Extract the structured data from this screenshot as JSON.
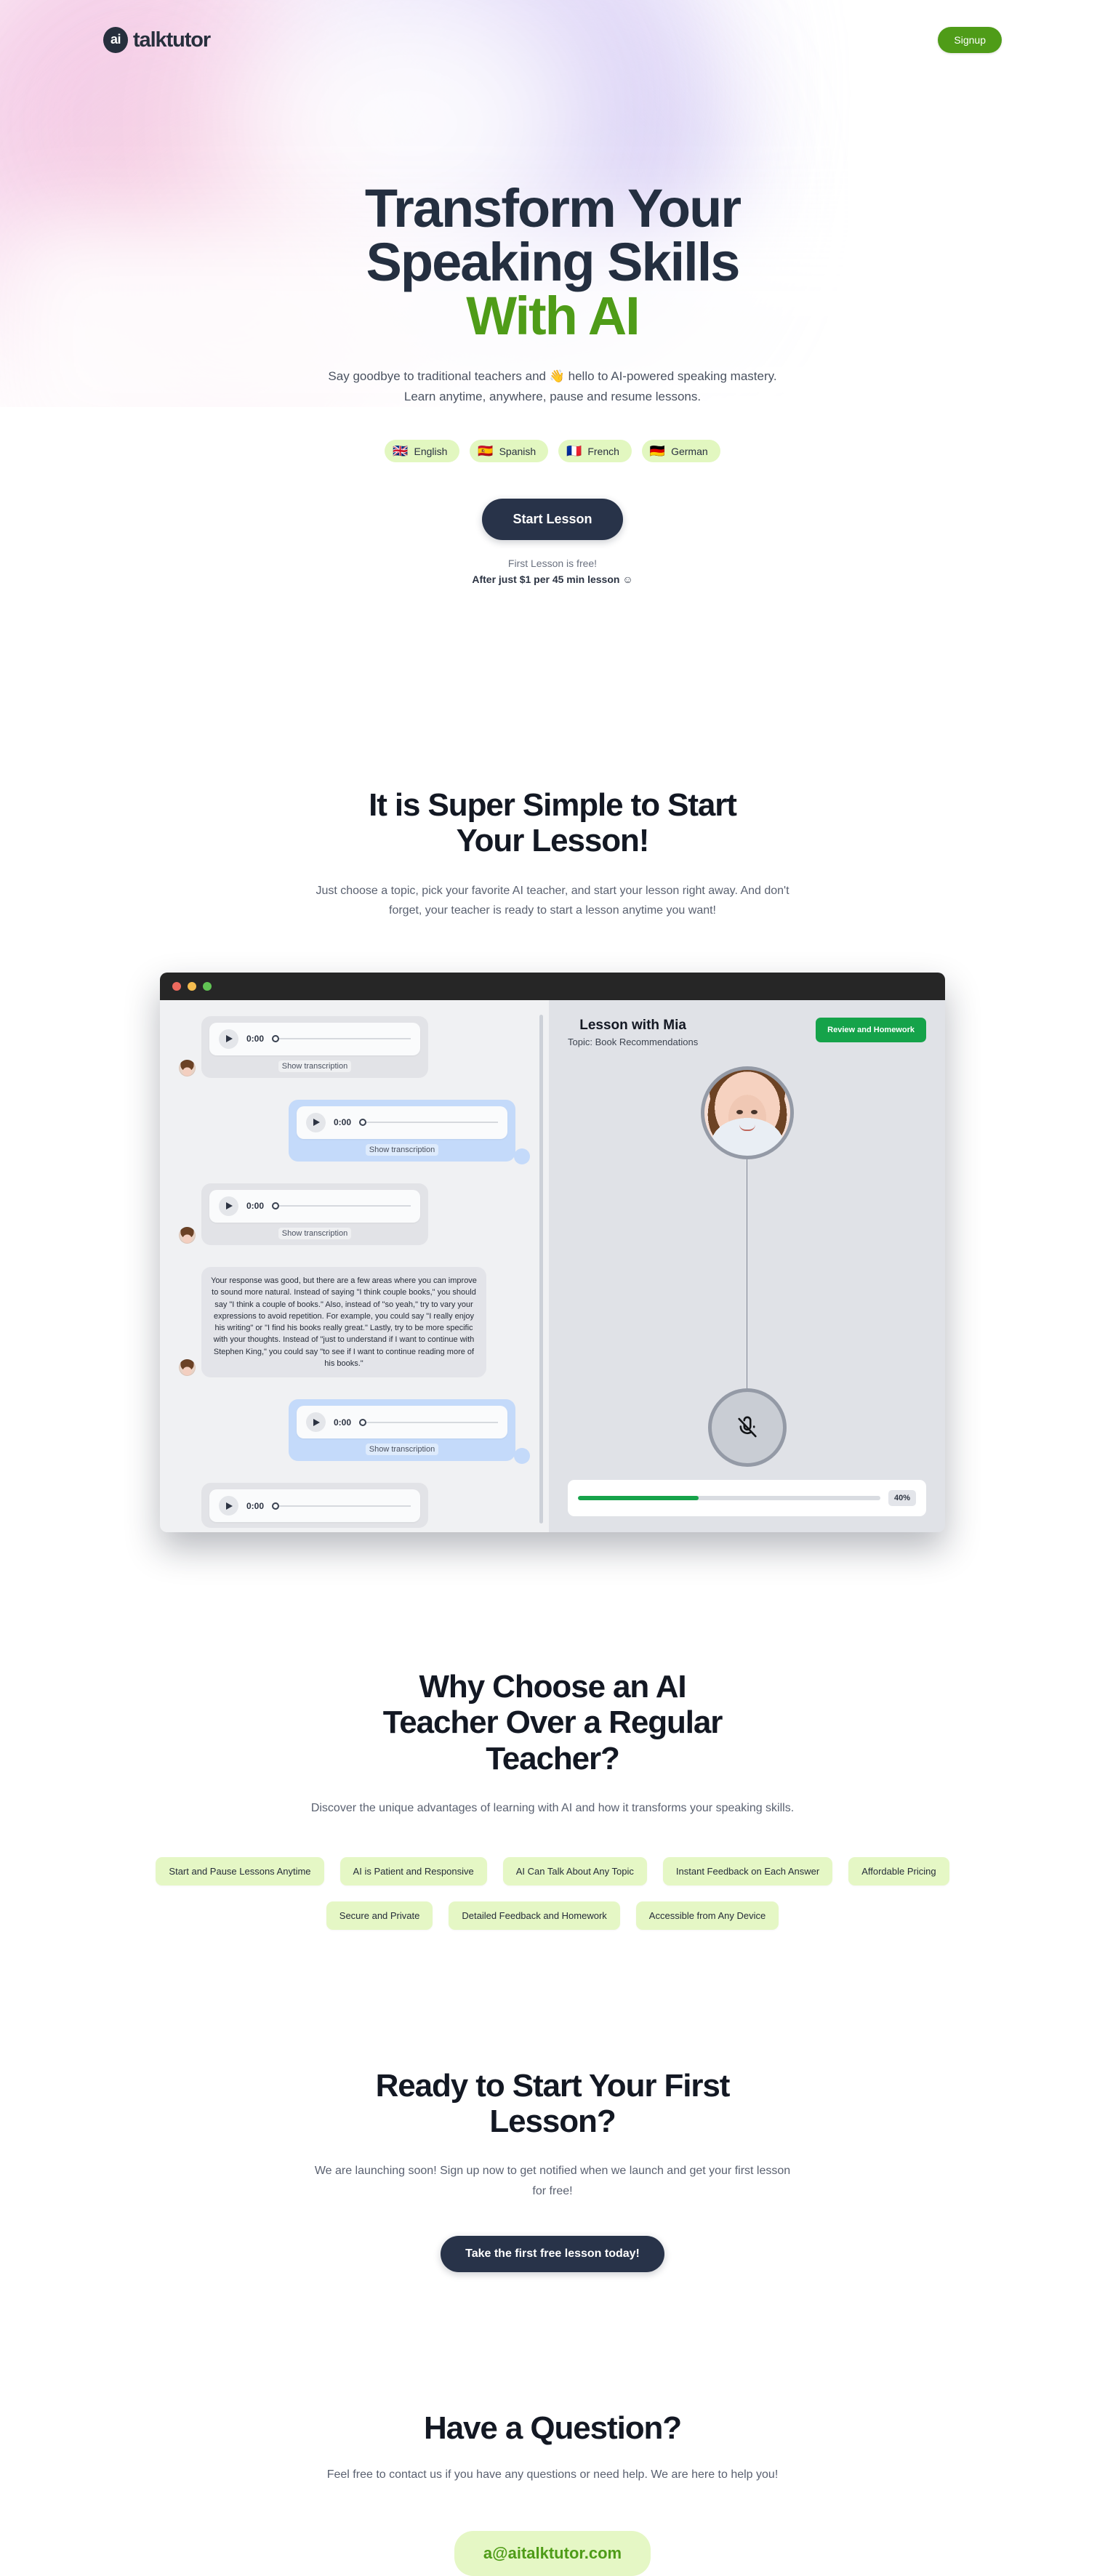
{
  "theme": {
    "accent_green": "#4f9c18",
    "dark_navy": "#283349",
    "pill_green_bg": "#e5f7c5",
    "button_green": "#15a34a"
  },
  "header": {
    "logo_badge": "ai",
    "logo_word": "talktutor",
    "signup_label": "Signup"
  },
  "hero": {
    "title_line1": "Transform Your",
    "title_line2": "Speaking Skills",
    "title_accent": "With AI",
    "subtitle": "Say goodbye to traditional teachers and 👋 hello to AI-powered speaking mastery. Learn anytime, anywhere, pause and resume lessons.",
    "languages": [
      {
        "flag": "🇬🇧",
        "label": "English"
      },
      {
        "flag": "🇪🇸",
        "label": "Spanish"
      },
      {
        "flag": "🇫🇷",
        "label": "French"
      },
      {
        "flag": "🇩🇪",
        "label": "German"
      }
    ],
    "cta_label": "Start Lesson",
    "note_free": "First Lesson is free!",
    "note_price": "After just $1 per 45 min lesson ☺"
  },
  "simple_section": {
    "title_line1": "It is Super Simple to Start",
    "title_line2": "Your Lesson!",
    "lead": "Just choose a topic, pick your favorite AI teacher, and start your lesson right away. And don't forget, your teacher is ready to start a lesson anytime you want!"
  },
  "mockup": {
    "window_dots": [
      "close",
      "minimize",
      "maximize"
    ],
    "chat": {
      "show_transcription_label": "Show transcription",
      "audio_time": "0:00",
      "messages": [
        {
          "type": "audio",
          "side": "in"
        },
        {
          "type": "audio",
          "side": "out"
        },
        {
          "type": "audio",
          "side": "in"
        },
        {
          "type": "text",
          "side": "in",
          "text": "Your response was good, but there are a few areas where you can improve to sound more natural. Instead of saying \"I think couple books,\" you should say \"I think a couple of books.\" Also, instead of \"so yeah,\" try to vary your expressions to avoid repetition. For example, you could say \"I really enjoy his writing\" or \"I find his books really great.\" Lastly, try to be more specific with your thoughts. Instead of \"just to understand if I want to continue with Stephen King,\" you could say \"to see if I want to continue reading more of his books.\""
        },
        {
          "type": "audio",
          "side": "out"
        },
        {
          "type": "audio",
          "side": "in"
        }
      ]
    },
    "lesson": {
      "title": "Lesson with Mia",
      "topic": "Topic: Book Recommendations",
      "review_button": "Review and Homework",
      "mic_state": "muted",
      "progress_percent": 40,
      "progress_label": "40%"
    }
  },
  "why_section": {
    "title_line1": "Why Choose an AI",
    "title_line2": "Teacher Over a Regular",
    "title_line3": "Teacher?",
    "lead": "Discover the unique advantages of learning with AI and how it transforms your speaking skills.",
    "features_row1": [
      "Start and Pause Lessons Anytime",
      "AI is Patient and Responsive",
      "AI Can Talk About Any Topic",
      "Instant Feedback on Each Answer",
      "Affordable Pricing"
    ],
    "features_row2": [
      "Secure and Private",
      "Detailed Feedback and Homework",
      "Accessible from Any Device"
    ]
  },
  "ready_section": {
    "title_line1": "Ready to Start Your First",
    "title_line2": "Lesson?",
    "lead": "We are launching soon! Sign up now to get notified when we launch and get your first lesson for free!",
    "cta_label": "Take the first free lesson today!"
  },
  "question_section": {
    "title": "Have a Question?",
    "lead": "Feel free to contact us if you have any questions or need help. We are here to help you!",
    "email": "a@aitalktutor.com"
  }
}
